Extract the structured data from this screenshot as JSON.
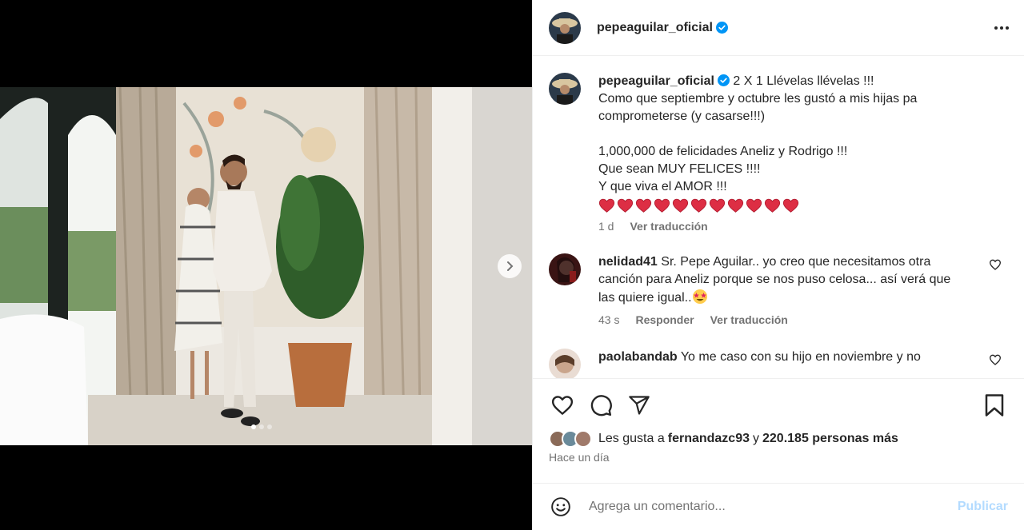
{
  "post": {
    "username": "pepeaguilar_oficial",
    "caption_lines": [
      "2 X 1 Llévelas llévelas !!!",
      "Como que septiembre y octubre les gustó a mis hijas pa",
      "comprometerse (y casarse!!!)",
      "",
      "1,000,000 de felicidades Aneliz y Rodrigo !!!",
      "Que sean MUY FELICES !!!!",
      "Y que viva el AMOR !!!"
    ],
    "heart_count": 11,
    "age": "1 d",
    "see_translation": "Ver traducción"
  },
  "comments": [
    {
      "username": "nelidad41",
      "lines": [
        "Sr. Pepe Aguilar.. yo creo que necesitamos otra",
        "canción para Aneliz porque se nos puso celosa... así verá que",
        "las quiere igual.."
      ],
      "emoji": "star-struck",
      "age": "43 s",
      "reply": "Responder",
      "translate": "Ver traducción"
    },
    {
      "username": "paolabandab",
      "lines": [
        "Yo me caso con su hijo en noviembre y no"
      ]
    }
  ],
  "likes": {
    "prefix": "Les gusta a",
    "user": "fernandazc93",
    "connector": "y",
    "others": "220.185 personas más"
  },
  "time_ago": "Hace un día",
  "add_comment": {
    "placeholder": "Agrega un comentario...",
    "publish": "Publicar"
  },
  "carousel": {
    "count": 3,
    "active": 0
  },
  "colors": {
    "verified": "#0095f6",
    "publish_disabled": "#b3dbff",
    "heart_red": "#e0245e"
  }
}
